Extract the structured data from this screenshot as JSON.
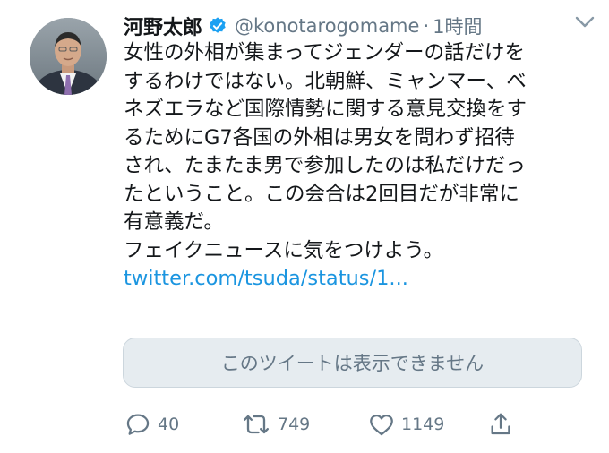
{
  "tweet": {
    "author_name": "河野太郎",
    "handle": "@konotarogomame",
    "separator": "·",
    "time": "1時間",
    "lines": [
      "女性の外相が集まってジェンダーの話だけを",
      "するわけではない。北朝鮮、ミャンマー、ベ",
      "ネズエラなど国際情勢に関する意見交換をす",
      "るためにG7各国の外相は男女を問わず招待",
      "され、たまたま男で参加したのは私だけだっ",
      "たということ。この会合は2回目だが非常に",
      "有意義だ。",
      "フェイクニュースに気をつけよう。"
    ],
    "link": "twitter.com/tsuda/status/1...",
    "quote_unavailable": "このツイートは表示できません",
    "actions": {
      "reply_count": "40",
      "retweet_count": "749",
      "like_count": "1149"
    }
  },
  "colors": {
    "link": "#1b95e0",
    "secondary_text": "#657786",
    "verified_badge": "#1da1f2",
    "quote_bg": "#e6ecf0"
  },
  "icons": [
    "verified-badge-icon",
    "caret-down-icon",
    "reply-icon",
    "retweet-icon",
    "like-icon",
    "share-icon"
  ]
}
